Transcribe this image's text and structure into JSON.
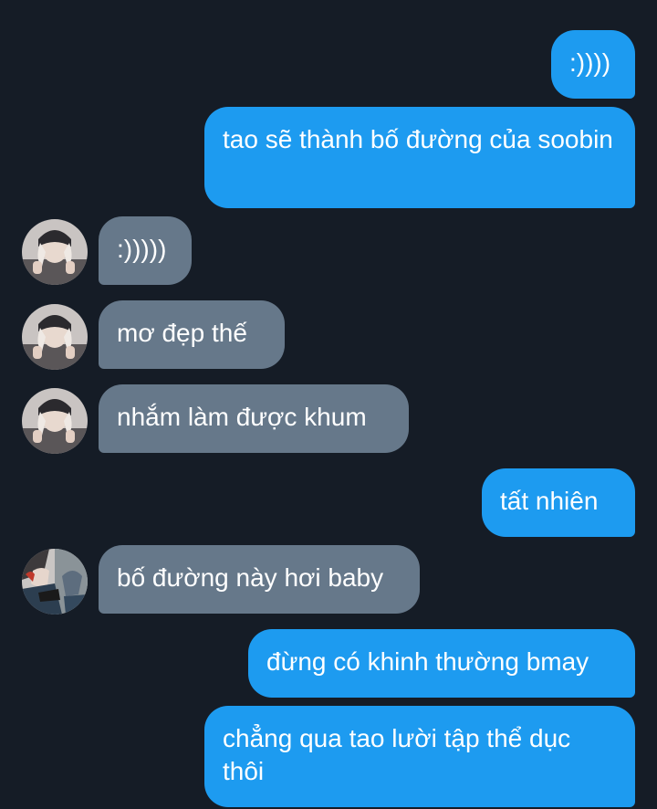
{
  "messages": [
    {
      "side": "sent",
      "text": ":))))"
    },
    {
      "side": "sent",
      "text": "tao sẽ thành bố đường của soobin"
    },
    {
      "side": "received",
      "text": ":)))))",
      "avatar": "avatar-user-1"
    },
    {
      "side": "received",
      "text": "mơ đẹp thế",
      "avatar": "avatar-user-1"
    },
    {
      "side": "received",
      "text": "nhắm làm được khum",
      "avatar": "avatar-user-1"
    },
    {
      "side": "sent",
      "text": "tất nhiên"
    },
    {
      "side": "received",
      "text": "bố đường này hơi baby",
      "avatar": "avatar-user-2"
    },
    {
      "side": "sent",
      "text": "đừng có khinh thường bmay"
    },
    {
      "side": "sent",
      "text": "chẳng qua tao lười tập thể dục thôi"
    }
  ],
  "colors": {
    "background": "#151c26",
    "sent_bubble": "#1d9bf0",
    "received_bubble": "#66788a",
    "text": "#ffffff"
  }
}
